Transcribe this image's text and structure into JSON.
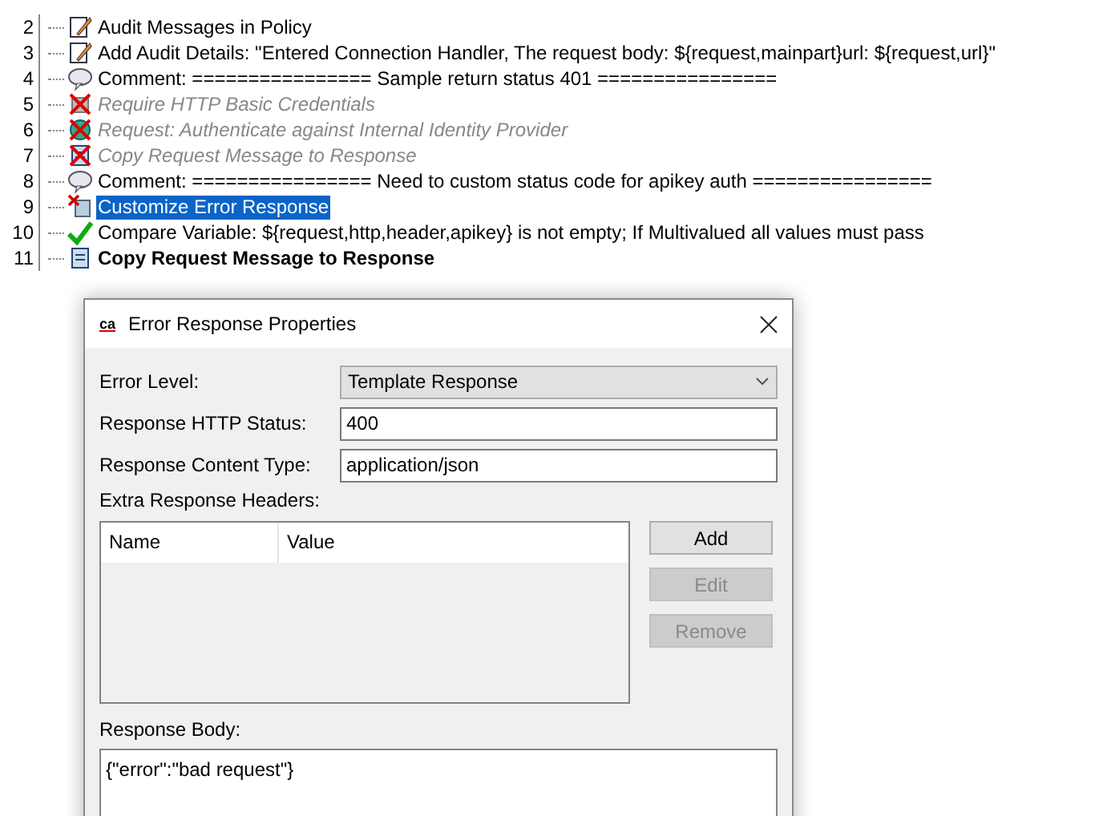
{
  "policy": {
    "rows": [
      {
        "number": "2",
        "kind": "audit",
        "text": "Audit Messages in Policy",
        "disabled": false,
        "selected": false,
        "bold": false
      },
      {
        "number": "3",
        "kind": "audit",
        "text": "Add Audit Details: \"Entered Connection Handler, The request body: ${request,mainpart}url:  ${request,url}\"",
        "disabled": false,
        "selected": false,
        "bold": false
      },
      {
        "number": "4",
        "kind": "comment",
        "text": "Comment: ================ Sample return status 401  ================",
        "disabled": false,
        "selected": false,
        "bold": false
      },
      {
        "number": "5",
        "kind": "credentials",
        "text": "Require HTTP Basic Credentials",
        "disabled": true,
        "selected": false,
        "bold": false
      },
      {
        "number": "6",
        "kind": "identity",
        "text": "Request: Authenticate against Internal Identity Provider",
        "disabled": true,
        "selected": false,
        "bold": false
      },
      {
        "number": "7",
        "kind": "copy",
        "text": "Copy Request Message to Response",
        "disabled": true,
        "selected": false,
        "bold": false
      },
      {
        "number": "8",
        "kind": "comment",
        "text": "Comment: ================ Need to custom status code for apikey auth  ================",
        "disabled": false,
        "selected": false,
        "bold": false
      },
      {
        "number": "9",
        "kind": "error",
        "text": "Customize Error Response",
        "disabled": false,
        "selected": true,
        "bold": false
      },
      {
        "number": "10",
        "kind": "compare",
        "text": "Compare Variable: ${request,http,header,apikey} is not empty; If Multivalued all values must pass",
        "disabled": false,
        "selected": false,
        "bold": false
      },
      {
        "number": "11",
        "kind": "copy",
        "text": "Copy Request Message to Response",
        "disabled": false,
        "selected": false,
        "bold": true
      }
    ]
  },
  "dialog": {
    "title": "Error Response Properties",
    "logo": "ca",
    "error_level": {
      "label": "Error Level:",
      "value": "Template Response"
    },
    "http_status": {
      "label": "Response HTTP Status:",
      "value": "400"
    },
    "content_type": {
      "label": "Response Content Type:",
      "value": "application/json"
    },
    "headers": {
      "label": "Extra Response Headers:",
      "columns": [
        "Name",
        "Value"
      ]
    },
    "buttons": [
      {
        "label": "Add",
        "disabled": false
      },
      {
        "label": "Edit",
        "disabled": true
      },
      {
        "label": "Remove",
        "disabled": true
      }
    ],
    "body": {
      "label": "Response Body:",
      "value": "{\"error\":\"bad request\"}"
    }
  }
}
